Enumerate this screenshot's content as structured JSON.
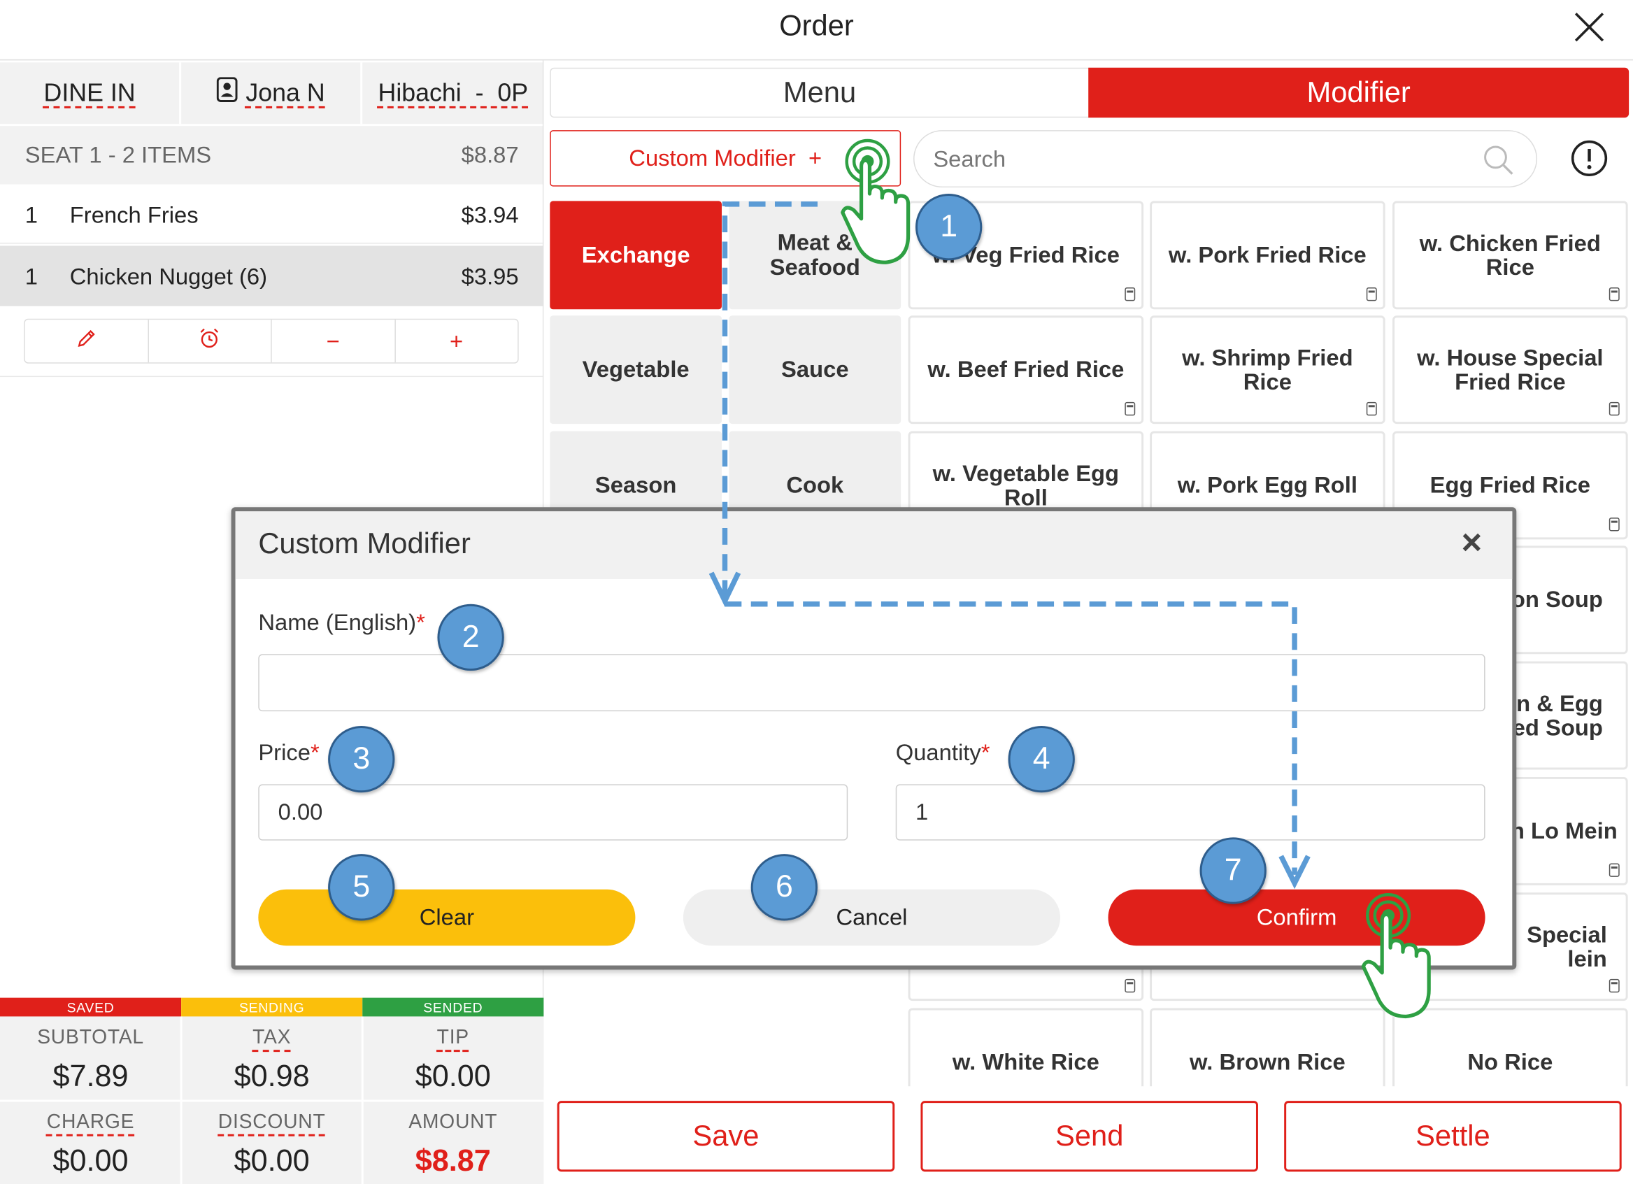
{
  "header": {
    "title": "Order"
  },
  "order_info": {
    "type": "DINE IN",
    "server": "Jona N",
    "table": "Hibachi  -  0P"
  },
  "seat": {
    "label": "SEAT 1 - 2 ITEMS",
    "total": "$8.87"
  },
  "items": [
    {
      "qty": "1",
      "name": "French Fries",
      "price": "$3.94"
    },
    {
      "qty": "1",
      "name": "Chicken Nugget (6)",
      "price": "$3.95"
    }
  ],
  "item_tools": [
    "pencil-icon",
    "alarm-clock-icon",
    "minus-icon",
    "plus-icon"
  ],
  "item_tool_glyphs": {
    "minus": "−",
    "plus": "+"
  },
  "status": {
    "saved": "SAVED",
    "sending": "SENDING",
    "sended": "SENDED"
  },
  "totals": {
    "subtotal_label": "SUBTOTAL",
    "subtotal": "$7.89",
    "tax_label": "TAX",
    "tax": "$0.98",
    "tip_label": "TIP",
    "tip": "$0.00",
    "charge_label": "CHARGE",
    "charge": "$0.00",
    "discount_label": "DISCOUNT",
    "discount": "$0.00",
    "amount_label": "AMOUNT",
    "amount": "$8.87"
  },
  "tabs": {
    "menu": "Menu",
    "modifier": "Modifier"
  },
  "custom_modifier_button": "Custom Modifier  +",
  "search": {
    "placeholder": "Search"
  },
  "categories": [
    "Exchange",
    "Meat &\nSeafood",
    "Vegetable",
    "Sauce",
    "Season",
    "Cook"
  ],
  "modifiers": [
    "w. Veg Fried Rice",
    "w. Pork Fried Rice",
    "w. Chicken Fried Rice",
    "w. Beef Fried Rice",
    "w. Shrimp Fried Rice",
    "w. House Special Fried Rice",
    "w. Vegetable Egg Roll",
    "w. Pork Egg Roll",
    "Egg Fried Rice",
    "w. White Rice",
    "w. Brown Rice",
    "No Rice"
  ],
  "partial_modifiers": [
    "on Soup",
    "on & Egg\ned Soup",
    "n Lo Mein",
    "Special\nlein"
  ],
  "actions": {
    "save": "Save",
    "send": "Send",
    "settle": "Settle"
  },
  "modal": {
    "title": "Custom Modifier",
    "name_label": "Name (English)",
    "name_value": "",
    "price_label": "Price",
    "price_value": "0.00",
    "quantity_label": "Quantity",
    "quantity_value": "1",
    "required_mark": "*",
    "clear": "Clear",
    "cancel": "Cancel",
    "confirm": "Confirm",
    "close_glyph": "×"
  },
  "steps": [
    "1",
    "2",
    "3",
    "4",
    "5",
    "6",
    "7"
  ],
  "colors": {
    "red": "#e0201a",
    "yellow": "#fbbf0b",
    "green": "#2ea043",
    "badge": "#5b9bd5",
    "flow": "#5b9bd5"
  }
}
